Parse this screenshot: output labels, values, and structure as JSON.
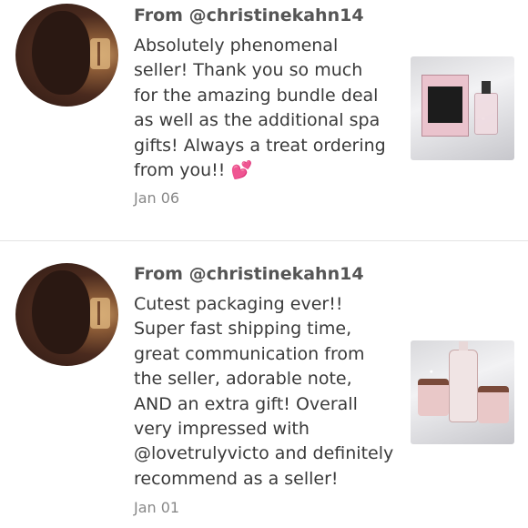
{
  "reviews": [
    {
      "from": "From @christinekahn14",
      "body": "Absolutely phenomenal\nseller! Thank you so much\nfor the amazing bundle deal\nas well as the additional spa\ngifts! Always a treat ordering\nfrom you!!",
      "emoji": "💕",
      "date": "Jan 06",
      "thumb": "perfume-bundle-photo"
    },
    {
      "from": "From @christinekahn14",
      "body": "Cutest packaging ever!!\nSuper fast shipping time,\ngreat communication from\nthe seller, adorable note,\nAND an extra gift! Overall\nvery impressed with\n@lovetrulyvicto and definitely\nrecommend as a seller!",
      "date": "Jan 01",
      "thumb": "spa-gift-photo"
    }
  ]
}
